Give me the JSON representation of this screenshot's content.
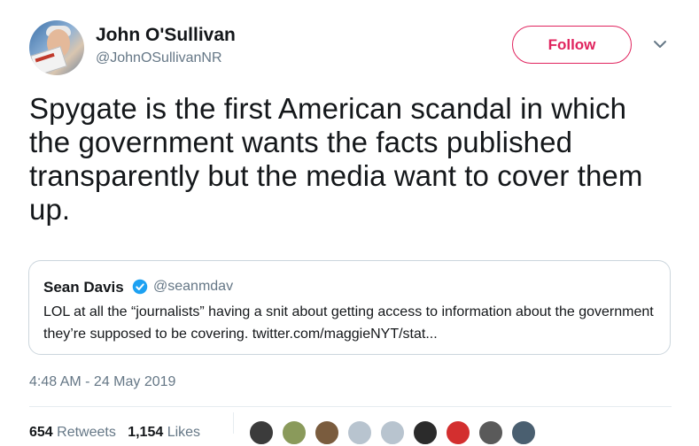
{
  "tweet": {
    "author_name": "John O'Sullivan",
    "author_handle": "@JohnOSullivanNR",
    "follow_label": "Follow",
    "text": "Spygate is the first American scandal in which the government wants the facts published transparently but the media want to cover them up.",
    "timestamp": "4:48 AM - 24 May 2019"
  },
  "quoted": {
    "name": "Sean Davis",
    "handle": "@seanmdav",
    "text": "LOL at all the “journalists” having a snit about getting access to information about the government they’re supposed to be covering. twitter.com/maggieNYT/stat..."
  },
  "stats": {
    "retweets_count": "654",
    "retweets_label": "Retweets",
    "likes_count": "1,154",
    "likes_label": "Likes"
  },
  "icons": {
    "more": "chevron-down-icon",
    "verified": "verified-badge-icon"
  },
  "colors": {
    "accent": "#e0245e",
    "verified": "#1da1f2",
    "secondary_text": "#657786",
    "border": "#ccd6dd"
  },
  "likers": [
    {
      "color": "#3b3b3b"
    },
    {
      "color": "#8a9a5b"
    },
    {
      "color": "#7a5c3e"
    },
    {
      "color": "#b8c4cf"
    },
    {
      "color": "#b8c4cf"
    },
    {
      "color": "#2b2b2b"
    },
    {
      "color": "#d32f2f"
    },
    {
      "color": "#5a5a5a"
    },
    {
      "color": "#4a5f70"
    }
  ]
}
